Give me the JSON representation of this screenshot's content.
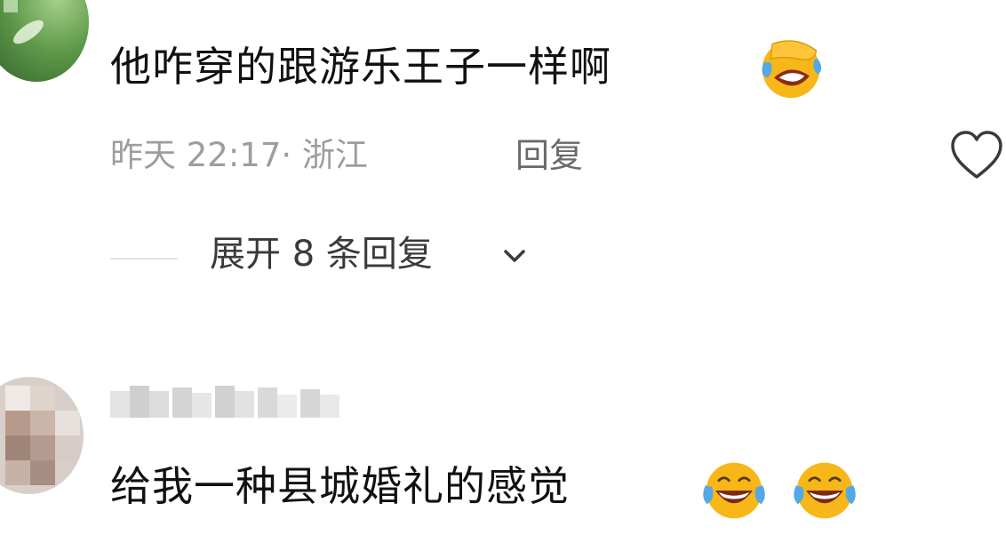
{
  "comment_1": {
    "text": "他咋穿的跟游乐王子一样啊",
    "emoji": "face-palm-crying-emoji",
    "timestamp_location": "昨天 22:17· 浙江",
    "reply_label": "回复",
    "like_icon": "heart-outline-icon"
  },
  "expand_replies": {
    "label": "展开 8 条回复",
    "icon": "chevron-down-icon"
  },
  "comment_2": {
    "text": "给我一种县城婚礼的感觉",
    "emojis": [
      "laughing-crying-emoji",
      "laughing-crying-emoji"
    ]
  },
  "colors": {
    "text_primary": "#111111",
    "text_meta": "#9d9d9d",
    "text_reply": "#6a6a6a",
    "text_expand": "#3a3a3a",
    "emoji_yellow": "#f7b719",
    "tear_blue": "#53a8e6"
  }
}
